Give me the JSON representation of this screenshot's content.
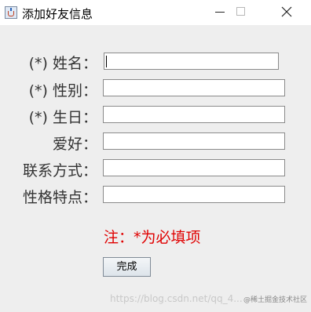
{
  "window": {
    "title": "添加好友信息",
    "icon": "java-cup-icon"
  },
  "form": {
    "fields": [
      {
        "label": "(*) 姓名：",
        "value": ""
      },
      {
        "label": "(*) 性别：",
        "value": ""
      },
      {
        "label": "(*) 生日：",
        "value": ""
      },
      {
        "label": "爱好：",
        "value": ""
      },
      {
        "label": "联系方式：",
        "value": ""
      },
      {
        "label": "性格特点：",
        "value": ""
      }
    ],
    "note": "注：*为必填项",
    "submit_label": "完成"
  },
  "watermark": {
    "text": "https://blog.csdn.net/qq_4...",
    "brand": "@稀土掘金技术社区"
  },
  "colors": {
    "note": "#e00000",
    "window_bg": "#eeeeee"
  }
}
